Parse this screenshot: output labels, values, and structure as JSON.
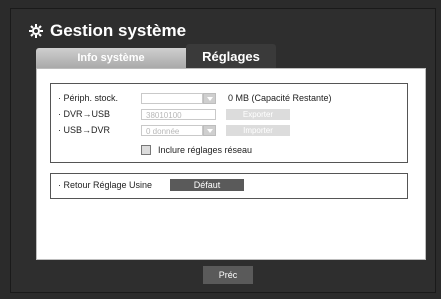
{
  "window": {
    "title": "Gestion système"
  },
  "tabs": [
    {
      "label": "Info système",
      "active": false
    },
    {
      "label": "Réglages",
      "active": true
    }
  ],
  "settings": {
    "storage_label": "· Périph. stock.",
    "storage_value": "",
    "capacity_text": "0 MB (Capacité Restante)",
    "dvr_usb_label": "· DVR→USB",
    "dvr_usb_value": "38010100",
    "export_button": "Exporter",
    "usb_dvr_label": "· USB→DVR",
    "usb_dvr_value": "0 donnée",
    "import_button": "Importer",
    "include_network_label": "Inclure réglages réseau",
    "include_network_checked": false
  },
  "factory": {
    "label": "· Retour Réglage Usine",
    "default_button": "Défaut"
  },
  "footer": {
    "prev_button": "Préc"
  },
  "colors": {
    "dark_bg": "#2e2e2e",
    "button_dark": "#5a5a5a",
    "disabled": "#dcdcdc"
  }
}
